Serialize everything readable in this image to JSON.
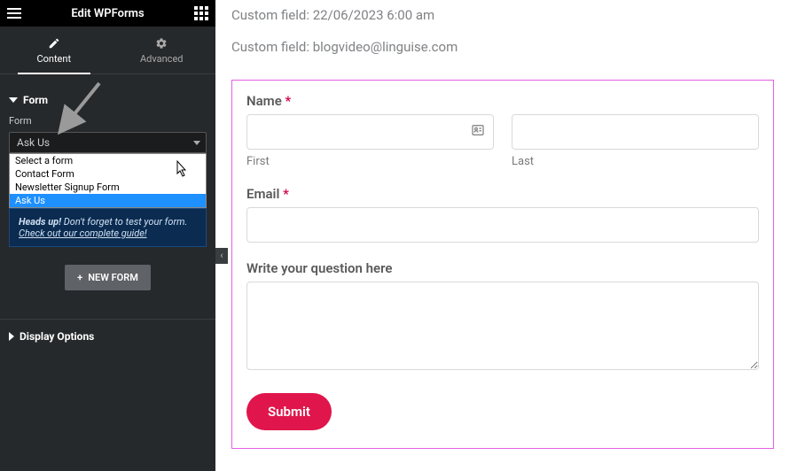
{
  "header": {
    "title": "Edit WPForms"
  },
  "tabs": {
    "content": "Content",
    "advanced": "Advanced"
  },
  "sidebar": {
    "section_form": "Form",
    "form_label": "Form",
    "select_value": "Ask Us",
    "dropdown": {
      "placeholder": "Select a form",
      "options": [
        "Contact Form",
        "Newsletter Signup Form",
        "Ask Us"
      ]
    },
    "notice": {
      "strong": "Heads up!",
      "text": " Don't forget to test your form. ",
      "link": "Check out our complete guide!"
    },
    "new_form_btn": "NEW FORM",
    "display_options": "Display Options"
  },
  "content": {
    "custom_field_1": "Custom field: 22/06/2023 6:00 am",
    "custom_field_2": "Custom field: blogvideo@linguise.com",
    "name_label": "Name",
    "first_label": "First",
    "last_label": "Last",
    "email_label": "Email",
    "question_label": "Write your question here",
    "submit": "Submit",
    "required": " *"
  },
  "colors": {
    "accent_pink": "#e0154b",
    "form_border": "#e55ee5"
  }
}
